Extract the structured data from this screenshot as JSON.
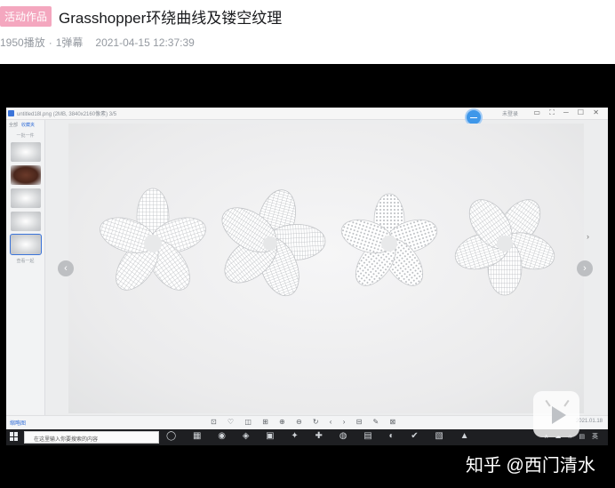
{
  "header": {
    "badge": "活动作品",
    "title": "Grasshopper环绕曲线及镂空纹理",
    "plays": "1950播放",
    "separator": "·",
    "danmaku": "1弹幕",
    "datetime": "2021-04-15 12:37:39"
  },
  "viewer": {
    "filename": "untitled18l.png (2MB, 3840x2160像素)  3/5",
    "user": "未登录",
    "window_controls": "▭ ⛶ ─ ☐ ✕",
    "side_tabs": [
      "全部",
      "收藏夹"
    ],
    "side_caption": "一批一件",
    "side_footer": "查看一起",
    "toolbar_left": "缩略图",
    "toolbar_right": "2021.01.18",
    "nav_prev": "‹",
    "nav_next": "›",
    "side_chevron": "›",
    "toolbar_icons": "⊡ ♡ ◫ ⊞ ⊕ ⊖ ↻ ‹ › ⊟ ✎ ⊠"
  },
  "taskbar": {
    "search_placeholder": "在这里输入你要搜索的内容",
    "app_icons": "◯ ▦ ◉ ◈ ▣ ✦ ✚ ◍ ▤ ◐ ✔ ▧ ▲",
    "tray": "ʌ ☁ ⌂ ▤ 英"
  },
  "watermark": {
    "text": "知乎 @西门清水"
  },
  "colors": {
    "badge_bg": "#f4a7bf",
    "player_bg": "#000000",
    "accent": "#3b74d9"
  }
}
